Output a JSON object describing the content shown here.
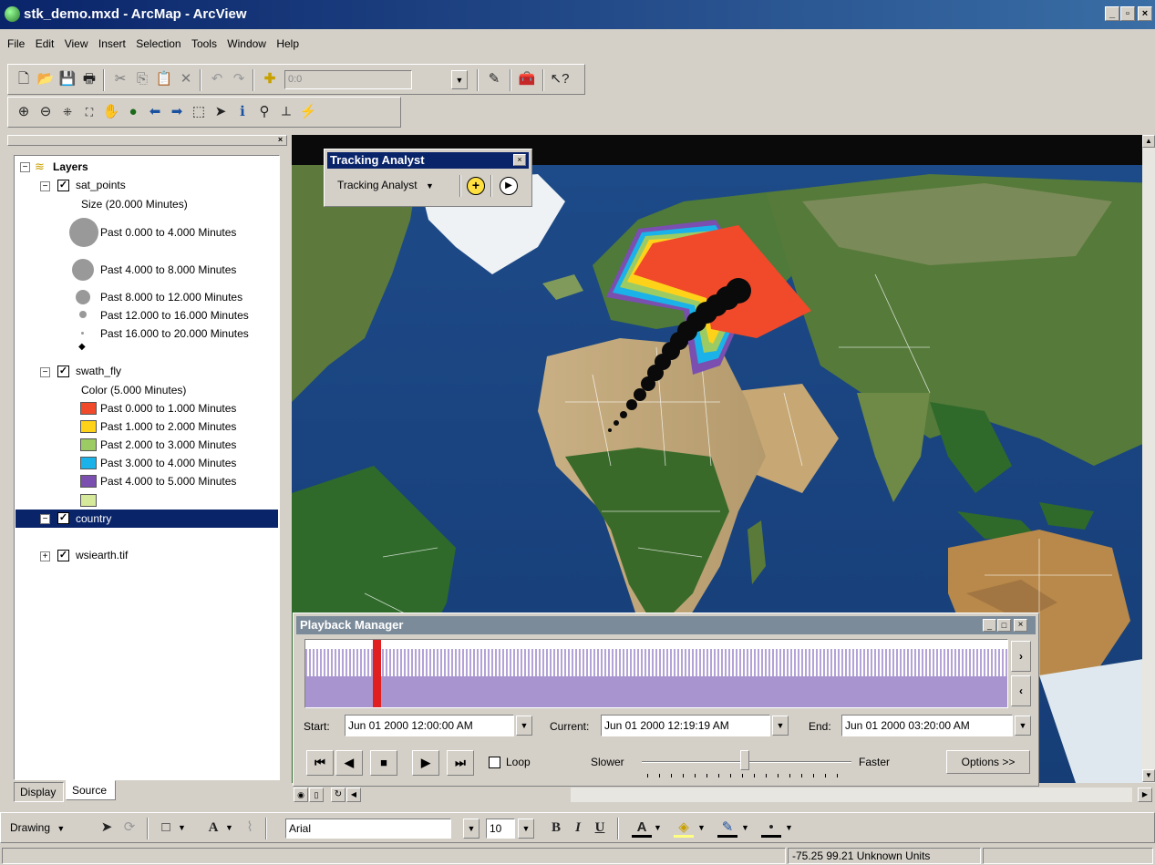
{
  "window": {
    "title": "stk_demo.mxd - ArcMap - ArcView"
  },
  "menu": [
    "File",
    "Edit",
    "View",
    "Insert",
    "Selection",
    "Tools",
    "Window",
    "Help"
  ],
  "toolbar": {
    "scale_value": "0:0"
  },
  "toc": {
    "root": "Layers",
    "sat_points": {
      "name": "sat_points",
      "subtitle": "Size (20.000 Minutes)",
      "items": [
        "Past 0.000 to 4.000 Minutes",
        "Past 4.000 to 8.000 Minutes",
        "Past 8.000 to 12.000 Minutes",
        "Past 12.000 to 16.000 Minutes",
        "Past 16.000 to 20.000 Minutes"
      ]
    },
    "swath_fly": {
      "name": "swath_fly",
      "subtitle": "Color (5.000 Minutes)",
      "items": [
        {
          "label": "Past 0.000 to 1.000 Minutes",
          "color": "#f04a2a"
        },
        {
          "label": "Past 1.000 to 2.000 Minutes",
          "color": "#ffd21a"
        },
        {
          "label": "Past 2.000 to 3.000 Minutes",
          "color": "#9ccb64"
        },
        {
          "label": "Past 3.000 to 4.000 Minutes",
          "color": "#1ab2e8"
        },
        {
          "label": "Past 4.000 to 5.000 Minutes",
          "color": "#7a4fb0"
        }
      ],
      "extra_color": "#d6e89a"
    },
    "country": {
      "name": "country"
    },
    "wsiearth": {
      "name": "wsiearth.tif"
    },
    "tabs": [
      "Display",
      "Source"
    ]
  },
  "tracking_analyst": {
    "title": "Tracking Analyst",
    "menu_label": "Tracking Analyst"
  },
  "playback": {
    "title": "Playback Manager",
    "start_label": "Start:",
    "start_value": "Jun 01 2000 12:00:00 AM",
    "current_label": "Current:",
    "current_value": "Jun 01 2000 12:19:19 AM",
    "end_label": "End:",
    "end_value": "Jun 01 2000 03:20:00 AM",
    "loop_label": "Loop",
    "slower_label": "Slower",
    "faster_label": "Faster",
    "options_label": "Options >>"
  },
  "drawing": {
    "label": "Drawing",
    "font_name": "Arial",
    "font_size": "10"
  },
  "status": {
    "coords": "-75.25  99.21 Unknown Units"
  }
}
